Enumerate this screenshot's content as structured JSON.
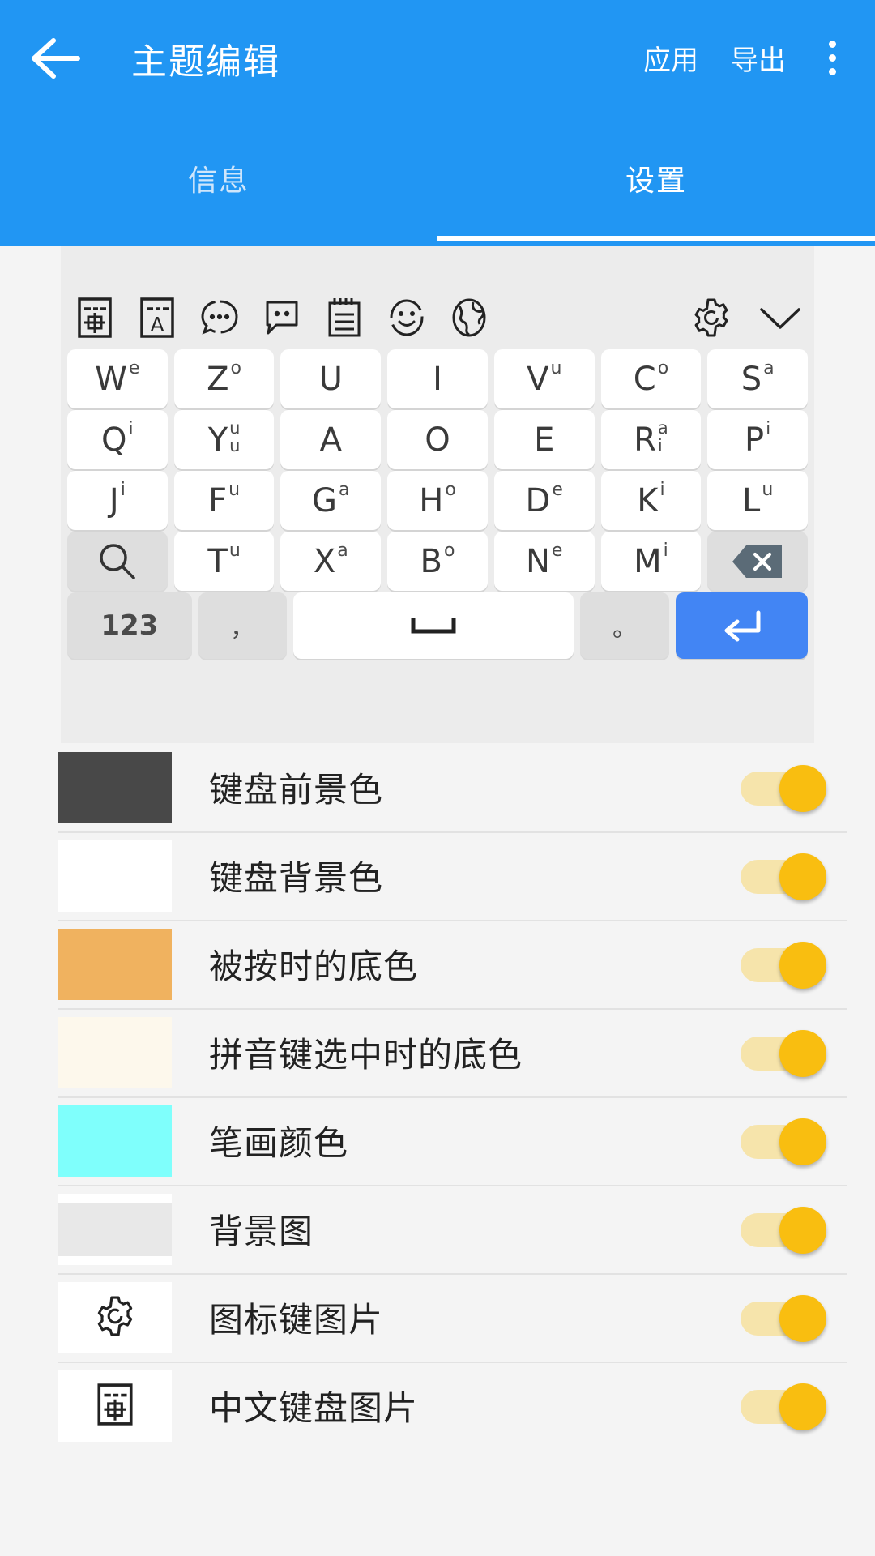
{
  "appbar": {
    "back_icon": "arrow-left-icon",
    "title": "主题编辑",
    "action_apply": "应用",
    "action_export": "导出",
    "overflow_icon": "more-vertical-icon",
    "background_color": "#2196F3"
  },
  "tabs": [
    {
      "label": "信息",
      "active": false
    },
    {
      "label": "设置",
      "active": true
    }
  ],
  "keyboard_preview": {
    "background_color": "#ECECEC",
    "toolbar_left": [
      {
        "icon": "chinese-input-icon",
        "glyph": "中"
      },
      {
        "icon": "latin-input-icon",
        "glyph": "A"
      },
      {
        "icon": "dots-bubble-icon"
      },
      {
        "icon": "speech-bubble-icon"
      },
      {
        "icon": "clipboard-icon"
      },
      {
        "icon": "smiley-icon"
      },
      {
        "icon": "globe-icon"
      }
    ],
    "toolbar_right": [
      {
        "icon": "gear-icon"
      },
      {
        "icon": "chevron-down-icon"
      }
    ],
    "rows": [
      {
        "keys": [
          {
            "main": "W",
            "sup": "e"
          },
          {
            "main": "Z",
            "sup": "o"
          },
          {
            "main": "U",
            "sup": ""
          },
          {
            "main": "I",
            "sup": ""
          },
          {
            "main": "V",
            "sup": "u"
          },
          {
            "main": "C",
            "sup": "o"
          },
          {
            "main": "S",
            "sup": "a"
          }
        ]
      },
      {
        "keys": [
          {
            "main": "Q",
            "sup": "i"
          },
          {
            "main": "Y",
            "sup_stack": [
              "u",
              "u"
            ]
          },
          {
            "main": "A",
            "sup": ""
          },
          {
            "main": "O",
            "sup": ""
          },
          {
            "main": "E",
            "sup": ""
          },
          {
            "main": "R",
            "sup_stack": [
              "a",
              "i"
            ]
          },
          {
            "main": "P",
            "sup": "i"
          }
        ]
      },
      {
        "keys": [
          {
            "main": "J",
            "sup": "i"
          },
          {
            "main": "F",
            "sup": "u"
          },
          {
            "main": "G",
            "sup": "a"
          },
          {
            "main": "H",
            "sup": "o"
          },
          {
            "main": "D",
            "sup": "e"
          },
          {
            "main": "K",
            "sup": "i"
          },
          {
            "main": "L",
            "sup": "u"
          }
        ]
      },
      {
        "keys": [
          {
            "icon": "search-icon",
            "func": true
          },
          {
            "main": "T",
            "sup": "u"
          },
          {
            "main": "X",
            "sup": "a"
          },
          {
            "main": "B",
            "sup": "o"
          },
          {
            "main": "N",
            "sup": "e"
          },
          {
            "main": "M",
            "sup": "i"
          },
          {
            "icon": "backspace-icon",
            "func": true
          }
        ]
      }
    ],
    "bottom_row": {
      "numeric_label": "123",
      "comma_label": "，",
      "space_icon": "space-icon",
      "period_label": "。",
      "enter_icon": "enter-icon",
      "enter_color": "#4285F4"
    }
  },
  "settings": {
    "rows": [
      {
        "label": "键盘前景色",
        "swatch_type": "color",
        "swatch_color": "#484848",
        "toggle_on": true
      },
      {
        "label": "键盘背景色",
        "swatch_type": "color",
        "swatch_color": "#FFFFFF",
        "toggle_on": true
      },
      {
        "label": "被按时的底色",
        "swatch_type": "color",
        "swatch_color": "#F0B25F",
        "toggle_on": true
      },
      {
        "label": "拼音键选中时的底色",
        "swatch_type": "color",
        "swatch_color": "#FDF8EC",
        "toggle_on": true
      },
      {
        "label": "笔画颜色",
        "swatch_type": "color",
        "swatch_color": "#7FFFFC",
        "toggle_on": true
      },
      {
        "label": "背景图",
        "swatch_type": "background-image",
        "swatch_color": "#E8E8E8",
        "toggle_on": true
      },
      {
        "label": "图标键图片",
        "swatch_type": "icon",
        "icon": "gear-icon",
        "toggle_on": true
      },
      {
        "label": "中文键盘图片",
        "swatch_type": "icon",
        "icon": "chinese-input-icon",
        "toggle_on": true
      }
    ],
    "toggle_track_color": "#F6E4AB",
    "toggle_thumb_color": "#F9BE10"
  }
}
